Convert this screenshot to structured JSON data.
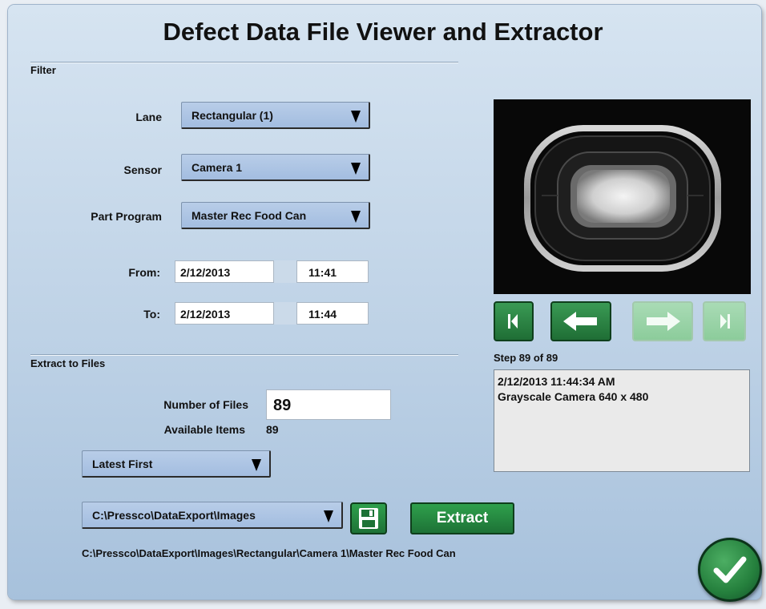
{
  "title": "Defect Data File Viewer and Extractor",
  "filter": {
    "section_label": "Filter",
    "lane": {
      "label": "Lane",
      "value": "Rectangular (1)"
    },
    "sensor": {
      "label": "Sensor",
      "value": "Camera 1"
    },
    "part_program": {
      "label": "Part Program",
      "value": "Master Rec Food Can"
    },
    "from": {
      "label": "From:",
      "date": "2/12/2013",
      "time": "11:41"
    },
    "to": {
      "label": "To:",
      "date": "2/12/2013",
      "time": "11:44"
    }
  },
  "extract": {
    "section_label": "Extract to Files",
    "number_of_files_label": "Number of Files",
    "number_of_files_value": "89",
    "available_items_label": "Available Items",
    "available_items_value": "89",
    "order": "Latest First",
    "folder": "C:\\Pressco\\DataExport\\Images",
    "extract_label": "Extract",
    "full_path": "C:\\Pressco\\DataExport\\Images\\Rectangular\\Camera 1\\Master Rec Food Can"
  },
  "viewer": {
    "step_text": "Step 89 of 89",
    "info_line1": "2/12/2013 11:44:34 AM",
    "info_line2": "Grayscale Camera 640 x 480",
    "buttons": [
      {
        "name": "first",
        "enabled": true,
        "icon": "skip-first-icon"
      },
      {
        "name": "previous",
        "enabled": true,
        "icon": "arrow-left-icon"
      },
      {
        "name": "next",
        "enabled": false,
        "icon": "arrow-right-icon"
      },
      {
        "name": "last",
        "enabled": false,
        "icon": "skip-last-icon"
      }
    ]
  },
  "colors": {
    "button_green": "#25803d",
    "button_green_disabled": "#8ccc9b",
    "dropdown_blue": "#a3bde0"
  }
}
